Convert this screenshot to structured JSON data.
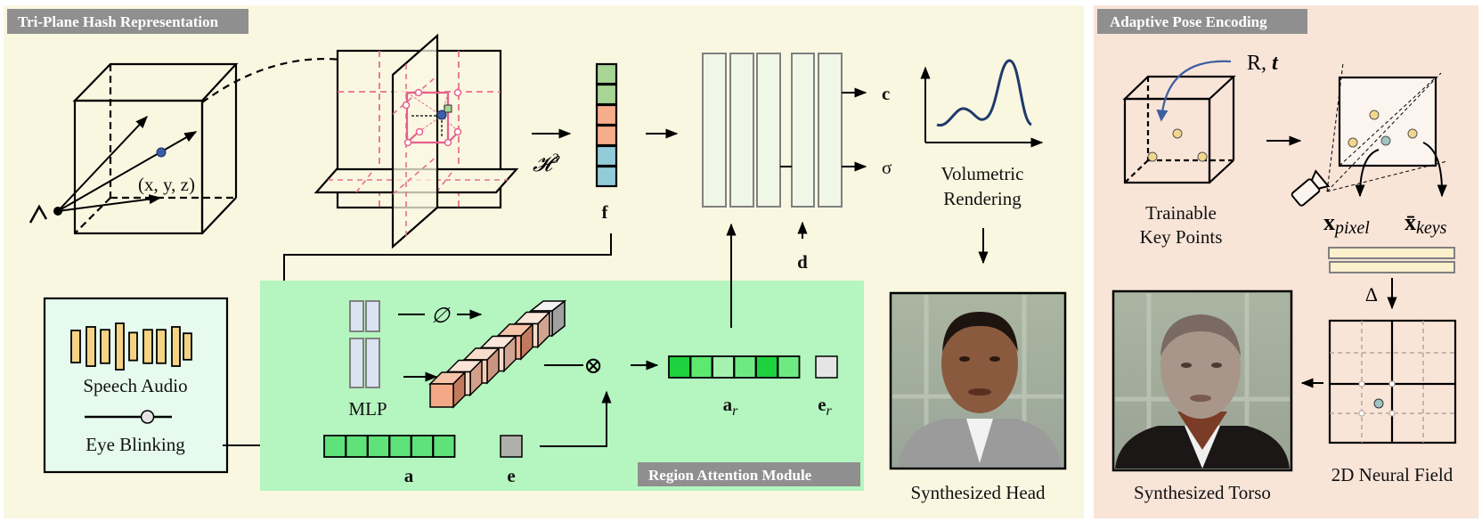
{
  "panels": {
    "triplane": {
      "title": "Tri-Plane Hash Representation",
      "bg": "#faf7e1"
    },
    "pose": {
      "title": "Adaptive Pose Encoding",
      "bg": "#f9e4d8"
    },
    "region_attention": {
      "title": "Region Attention  Module",
      "bg": "#b5f5c0"
    }
  },
  "colors": {
    "header_bg": "#8f8f8f",
    "plane_dash": "#e5708a",
    "point_blue": "#3a5ea6",
    "feat_green": "#a8d595",
    "feat_orange": "#f6ad8c",
    "feat_cyan": "#92ccd8",
    "mlp_fill": "#f0f7e6",
    "audio_bar": "#f5d385",
    "audio_box": "#e6fbee",
    "curve": "#1f3a6b",
    "keypoint": "#f2d68c",
    "teal_point": "#9fc4c4",
    "encoding_bar": "#fdf0cc"
  },
  "labels": {
    "point_coords": "(x, y, z)",
    "hash_op": "𝓗",
    "hash_power": "3",
    "feature": "f",
    "out_color": "c",
    "out_density": "σ",
    "view_dir": "d",
    "volumetric_rendering": [
      "Volumetric",
      "Rendering"
    ],
    "speech_audio": "Speech Audio",
    "eye_blinking": "Eye Blinking",
    "mlp": "MLP",
    "audio_feat": "a",
    "eye_feat": "e",
    "audio_region": "a",
    "eye_region": "e",
    "region_sub": "r",
    "multiply": "⊗",
    "sigmoid": "σ̸",
    "synth_head": "Synthesized Head",
    "pose_rt": "R, ",
    "pose_t": "t",
    "trainable_kp": [
      "Trainable",
      "Key Points"
    ],
    "x_pixel": "x",
    "x_pixel_sub": "pixel",
    "x_keys": "x̄",
    "x_keys_sub": "keys",
    "delta": "Δ",
    "neural_field": "2D Neural Field",
    "synth_torso": "Synthesized Torso"
  },
  "feature_vector": {
    "cells": [
      "green",
      "green",
      "orange",
      "orange",
      "cyan",
      "cyan"
    ]
  },
  "audio_bars": [
    0.5,
    0.75,
    0.55,
    1.0,
    0.35,
    0.55,
    0.55,
    0.75,
    0.3
  ],
  "blink_slider": {
    "value": 0.72
  },
  "region_vector": {
    "cells": [
      "#1dd13f",
      "#5de870",
      "#a6f0b0",
      "#6eea82",
      "#1dd13f",
      "#6eea82"
    ],
    "eye_cell": "#e5e5e5"
  },
  "audio_vector": {
    "count": 6,
    "eye_cell": "#b0b0aa"
  }
}
